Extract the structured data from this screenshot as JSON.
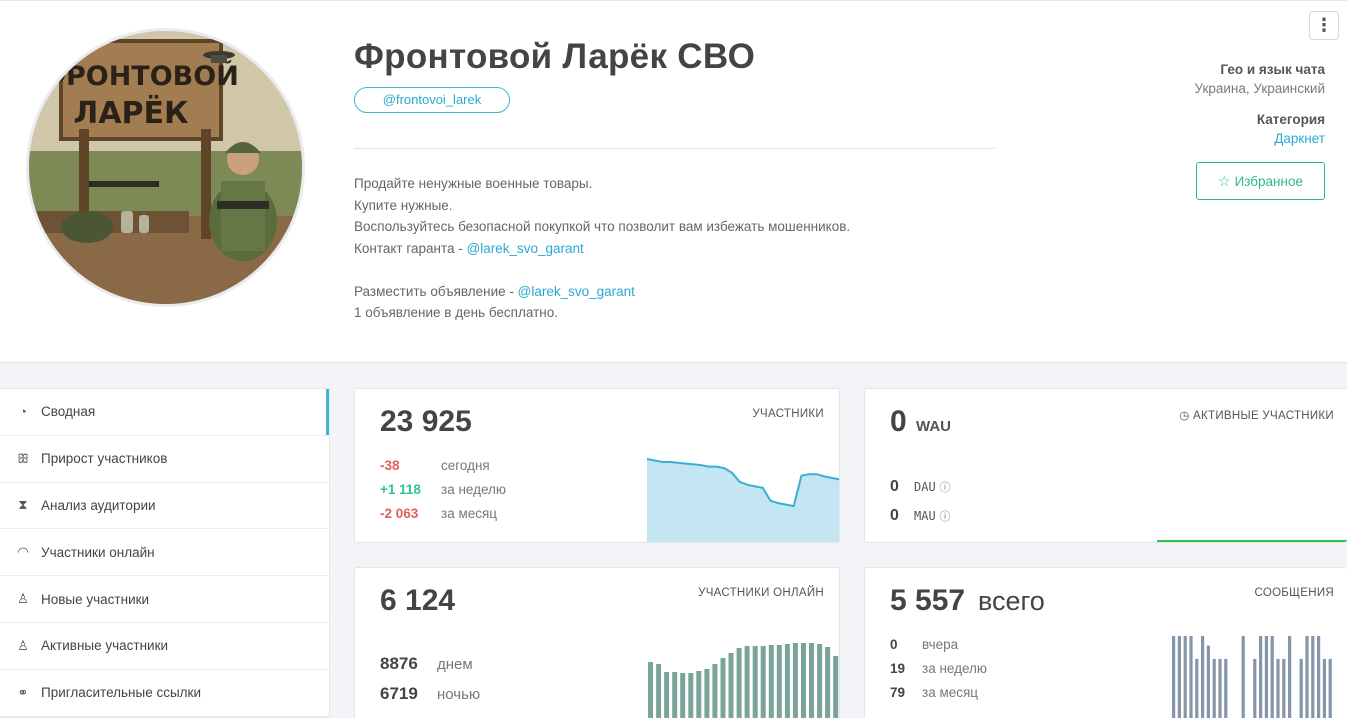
{
  "channel": {
    "title": "Фронтовой Ларёк СВО",
    "username": "@frontovoi_larek",
    "avatar_sign_line1": "ФРОНТОВОЙ",
    "avatar_sign_line2": "ЛАРЁК",
    "description": {
      "line1": "Продайте ненужные военные товары.",
      "line2": "Купите нужные.",
      "line3": "Воспользуйтесь безопасной покупкой что позволит вам избежать мошенников.",
      "line4_prefix": "Контакт гаранта - ",
      "line4_link": "@larek_svo_garant",
      "line5_prefix": "Разместить объявление - ",
      "line5_link": "@larek_svo_garant",
      "line6": "1 объявление в день бесплатно."
    }
  },
  "meta": {
    "geo_label": "Гео и язык чата",
    "geo_value": "Украина, Украинский",
    "category_label": "Категория",
    "category_value": "Даркнет",
    "favorite_label": "Избранное",
    "favorite_icon": "star-icon",
    "menu_icon": "more-vertical-icon"
  },
  "sidebar": {
    "items": [
      {
        "label": "Сводная",
        "icon": "dashboard-icon",
        "active": true
      },
      {
        "label": "Прирост участников",
        "icon": "users-icon"
      },
      {
        "label": "Анализ аудитории",
        "icon": "hourglass-icon"
      },
      {
        "label": "Участники онлайн",
        "icon": "wifi-icon"
      },
      {
        "label": "Новые участники",
        "icon": "user-plus-icon"
      },
      {
        "label": "Активные участники",
        "icon": "user-check-icon"
      },
      {
        "label": "Пригласительные ссылки",
        "icon": "link-icon"
      }
    ]
  },
  "cards": {
    "members": {
      "value": "23 925",
      "tag": "УЧАСТНИКИ",
      "rows": [
        {
          "delta": "-38",
          "label": "сегодня",
          "sign": "neg"
        },
        {
          "delta": "+1 118",
          "label": "за неделю",
          "sign": "pos"
        },
        {
          "delta": "-2 063",
          "label": "за месяц",
          "sign": "neg"
        }
      ],
      "sparkline": [
        100,
        98,
        96,
        96,
        95,
        94,
        93,
        92,
        90,
        90,
        88,
        82,
        70,
        66,
        64,
        62,
        45,
        42,
        40,
        38,
        78,
        80,
        80,
        77,
        75,
        73
      ]
    },
    "active": {
      "value": "0",
      "unit": "WAU",
      "tag": "АКТИВНЫЕ УЧАСТНИКИ",
      "tag_icon": "clock-icon",
      "dau_value": "0",
      "dau_label": "DAU",
      "mau_value": "0",
      "mau_label": "MAU",
      "help_icon": "help-circle-icon"
    },
    "online": {
      "value": "6 124",
      "tag": "УЧАСТНИКИ ОНЛАЙН",
      "day_value": "8876",
      "day_label": "днем",
      "night_value": "6719",
      "night_label": "ночью",
      "bars": [
        60,
        58,
        50,
        50,
        49,
        49,
        51,
        53,
        58,
        64,
        69,
        74,
        76,
        76,
        76,
        77,
        77,
        78,
        79,
        79,
        79,
        78,
        75,
        66
      ]
    },
    "messages": {
      "value": "5 557",
      "unit": "всего",
      "tag": "СООБЩЕНИЯ",
      "rows": [
        {
          "value": "0",
          "label": "вчера"
        },
        {
          "value": "19",
          "label": "за неделю"
        },
        {
          "value": "79",
          "label": "за месяц"
        }
      ],
      "bars": [
        90,
        90,
        90,
        90,
        66,
        90,
        80,
        66,
        66,
        66,
        0,
        0,
        90,
        0,
        66,
        90,
        90,
        90,
        66,
        66,
        90,
        0,
        66,
        90,
        90,
        90,
        66,
        66
      ]
    }
  },
  "colors": {
    "accent": "#41b4d8",
    "positive": "#2fc48b",
    "negative": "#e35d5d",
    "bar": "#7aa39a",
    "spark_fill": "#c3e6f2",
    "spark_line": "#3aaed6",
    "message_bar": "#8596a9",
    "active_line": "#2fc452"
  }
}
